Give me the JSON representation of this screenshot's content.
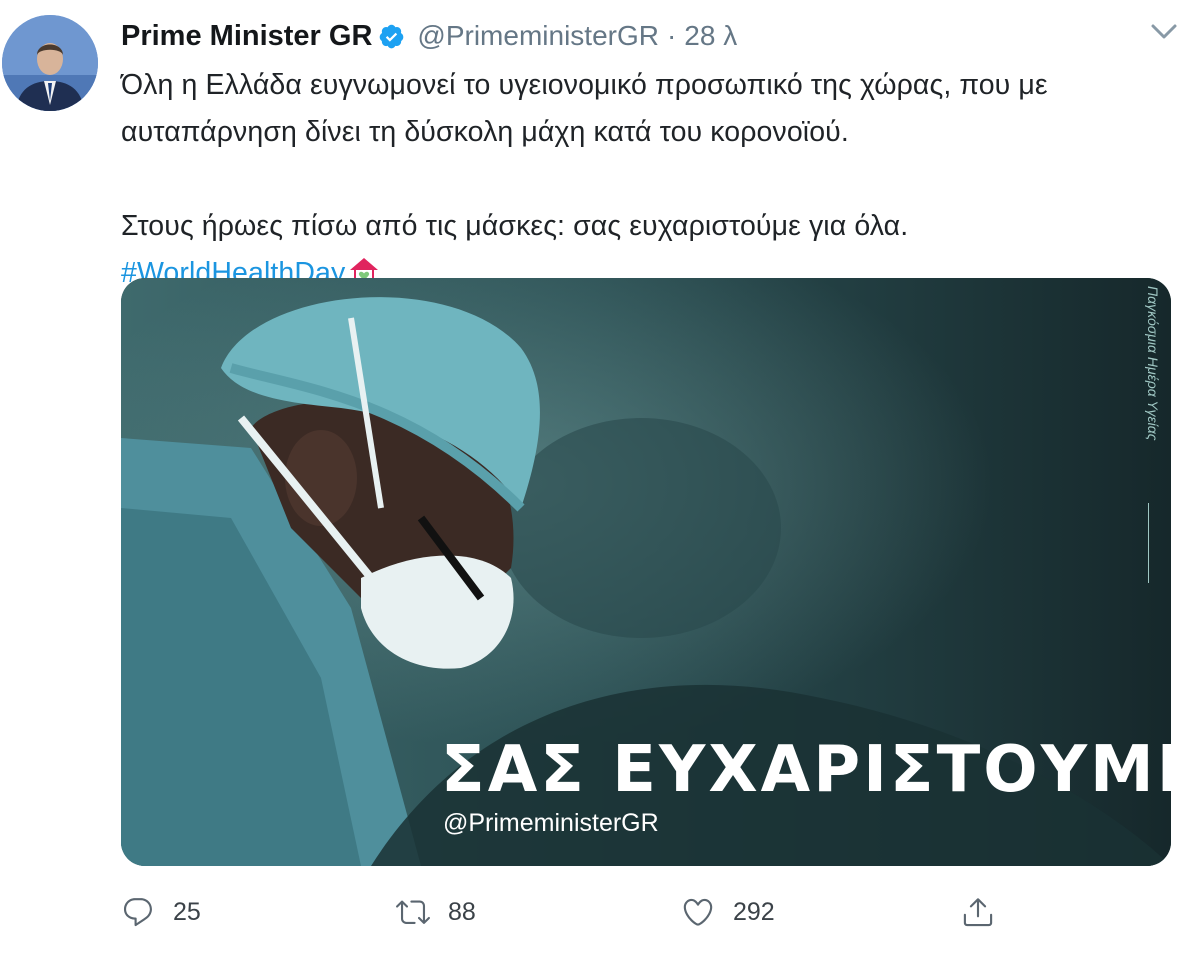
{
  "tweet": {
    "author": {
      "name": "Prime Minister GR",
      "handle": "@PrimeministerGR",
      "separator": "·",
      "time": "28 λ",
      "verified": true,
      "avatar_icon": "profile-photo"
    },
    "text": {
      "line1": "Όλη η Ελλάδα ευγνωμονεί το υγειονομικό προσωπικό της χώρας, που με",
      "line2": "αυταπάρνηση δίνει τη δύσκολη μάχη κατά του κορονοϊού.",
      "line3": "Στους ήρωες πίσω από τις μάσκες: σας ευχαριστούμε για όλα.",
      "hashtag": "#WorldHealthDay",
      "hashtag_emoji": "house-with-heart-emoji"
    },
    "media": {
      "title": "ΣΑΣ ΕΥΧΑΡΙΣΤΟΥΜΕ",
      "handle": "@PrimeministerGR",
      "side_caption": "Παγκόσμια Ημέρα Υγείας",
      "description_icon": "surgeon-photo"
    },
    "actions": {
      "replies": "25",
      "retweets": "88",
      "likes": "292"
    },
    "colors": {
      "hashtag": "#1b95e0",
      "verified": "#1da1f2",
      "muted": "#657786",
      "media_bg": "#1e3b3f"
    }
  }
}
